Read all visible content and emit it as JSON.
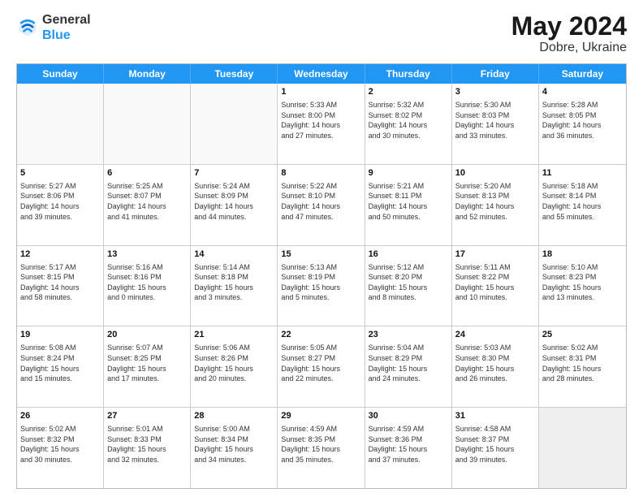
{
  "logo": {
    "line1": "General",
    "line2": "Blue"
  },
  "title": "May 2024",
  "location": "Dobre, Ukraine",
  "header_days": [
    "Sunday",
    "Monday",
    "Tuesday",
    "Wednesday",
    "Thursday",
    "Friday",
    "Saturday"
  ],
  "weeks": [
    [
      {
        "day": "",
        "info": ""
      },
      {
        "day": "",
        "info": ""
      },
      {
        "day": "",
        "info": ""
      },
      {
        "day": "1",
        "info": "Sunrise: 5:33 AM\nSunset: 8:00 PM\nDaylight: 14 hours\nand 27 minutes."
      },
      {
        "day": "2",
        "info": "Sunrise: 5:32 AM\nSunset: 8:02 PM\nDaylight: 14 hours\nand 30 minutes."
      },
      {
        "day": "3",
        "info": "Sunrise: 5:30 AM\nSunset: 8:03 PM\nDaylight: 14 hours\nand 33 minutes."
      },
      {
        "day": "4",
        "info": "Sunrise: 5:28 AM\nSunset: 8:05 PM\nDaylight: 14 hours\nand 36 minutes."
      }
    ],
    [
      {
        "day": "5",
        "info": "Sunrise: 5:27 AM\nSunset: 8:06 PM\nDaylight: 14 hours\nand 39 minutes."
      },
      {
        "day": "6",
        "info": "Sunrise: 5:25 AM\nSunset: 8:07 PM\nDaylight: 14 hours\nand 41 minutes."
      },
      {
        "day": "7",
        "info": "Sunrise: 5:24 AM\nSunset: 8:09 PM\nDaylight: 14 hours\nand 44 minutes."
      },
      {
        "day": "8",
        "info": "Sunrise: 5:22 AM\nSunset: 8:10 PM\nDaylight: 14 hours\nand 47 minutes."
      },
      {
        "day": "9",
        "info": "Sunrise: 5:21 AM\nSunset: 8:11 PM\nDaylight: 14 hours\nand 50 minutes."
      },
      {
        "day": "10",
        "info": "Sunrise: 5:20 AM\nSunset: 8:13 PM\nDaylight: 14 hours\nand 52 minutes."
      },
      {
        "day": "11",
        "info": "Sunrise: 5:18 AM\nSunset: 8:14 PM\nDaylight: 14 hours\nand 55 minutes."
      }
    ],
    [
      {
        "day": "12",
        "info": "Sunrise: 5:17 AM\nSunset: 8:15 PM\nDaylight: 14 hours\nand 58 minutes."
      },
      {
        "day": "13",
        "info": "Sunrise: 5:16 AM\nSunset: 8:16 PM\nDaylight: 15 hours\nand 0 minutes."
      },
      {
        "day": "14",
        "info": "Sunrise: 5:14 AM\nSunset: 8:18 PM\nDaylight: 15 hours\nand 3 minutes."
      },
      {
        "day": "15",
        "info": "Sunrise: 5:13 AM\nSunset: 8:19 PM\nDaylight: 15 hours\nand 5 minutes."
      },
      {
        "day": "16",
        "info": "Sunrise: 5:12 AM\nSunset: 8:20 PM\nDaylight: 15 hours\nand 8 minutes."
      },
      {
        "day": "17",
        "info": "Sunrise: 5:11 AM\nSunset: 8:22 PM\nDaylight: 15 hours\nand 10 minutes."
      },
      {
        "day": "18",
        "info": "Sunrise: 5:10 AM\nSunset: 8:23 PM\nDaylight: 15 hours\nand 13 minutes."
      }
    ],
    [
      {
        "day": "19",
        "info": "Sunrise: 5:08 AM\nSunset: 8:24 PM\nDaylight: 15 hours\nand 15 minutes."
      },
      {
        "day": "20",
        "info": "Sunrise: 5:07 AM\nSunset: 8:25 PM\nDaylight: 15 hours\nand 17 minutes."
      },
      {
        "day": "21",
        "info": "Sunrise: 5:06 AM\nSunset: 8:26 PM\nDaylight: 15 hours\nand 20 minutes."
      },
      {
        "day": "22",
        "info": "Sunrise: 5:05 AM\nSunset: 8:27 PM\nDaylight: 15 hours\nand 22 minutes."
      },
      {
        "day": "23",
        "info": "Sunrise: 5:04 AM\nSunset: 8:29 PM\nDaylight: 15 hours\nand 24 minutes."
      },
      {
        "day": "24",
        "info": "Sunrise: 5:03 AM\nSunset: 8:30 PM\nDaylight: 15 hours\nand 26 minutes."
      },
      {
        "day": "25",
        "info": "Sunrise: 5:02 AM\nSunset: 8:31 PM\nDaylight: 15 hours\nand 28 minutes."
      }
    ],
    [
      {
        "day": "26",
        "info": "Sunrise: 5:02 AM\nSunset: 8:32 PM\nDaylight: 15 hours\nand 30 minutes."
      },
      {
        "day": "27",
        "info": "Sunrise: 5:01 AM\nSunset: 8:33 PM\nDaylight: 15 hours\nand 32 minutes."
      },
      {
        "day": "28",
        "info": "Sunrise: 5:00 AM\nSunset: 8:34 PM\nDaylight: 15 hours\nand 34 minutes."
      },
      {
        "day": "29",
        "info": "Sunrise: 4:59 AM\nSunset: 8:35 PM\nDaylight: 15 hours\nand 35 minutes."
      },
      {
        "day": "30",
        "info": "Sunrise: 4:59 AM\nSunset: 8:36 PM\nDaylight: 15 hours\nand 37 minutes."
      },
      {
        "day": "31",
        "info": "Sunrise: 4:58 AM\nSunset: 8:37 PM\nDaylight: 15 hours\nand 39 minutes."
      },
      {
        "day": "",
        "info": ""
      }
    ]
  ]
}
